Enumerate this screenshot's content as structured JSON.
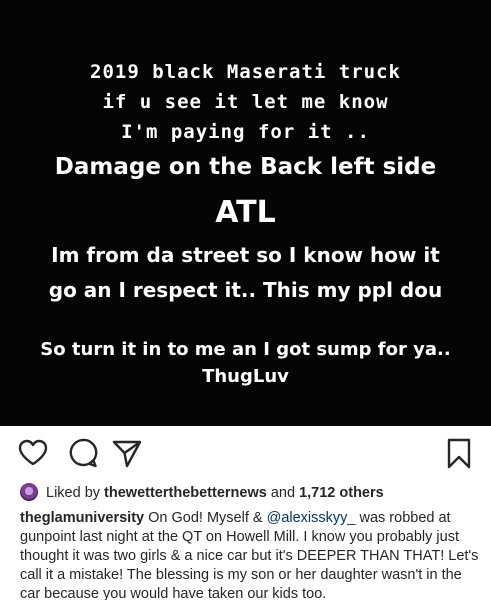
{
  "story": {
    "line1": "2019 black Maserati truck",
    "line2": "if u see it let me know",
    "line3": "I'm paying for it ..",
    "line4": "Damage on the Back left side",
    "line5": "ATL",
    "line6": "Im from da street so I know how it",
    "line7": "go an I respect it.. This my ppl dou",
    "line8": "So turn it in to me an I got sump for ya..",
    "line9": "ThugLuv"
  },
  "actions": {
    "like_icon": "heart-icon",
    "comment_icon": "comment-icon",
    "share_icon": "paper-plane-icon",
    "save_icon": "bookmark-icon"
  },
  "likes": {
    "prefix": "Liked by",
    "user": "thewetterthebetternews",
    "and": "and",
    "count": "1,712 others"
  },
  "caption": {
    "username": "theglamuniversity",
    "text_before": " On God! Myself & ",
    "mention": "@alexisskyy_",
    "text_after": " was robbed at gunpoint last night at the QT on Howell Mill. I know you probably just thought it was two girls & a nice car but it's DEEPER THAN THAT! Let's call it a mistake! The blessing is my son or her daughter wasn't in the car because you would have taken our kids too."
  },
  "colors": {
    "story_bg": "#050505",
    "text": "#262626",
    "mention": "#00376b"
  }
}
